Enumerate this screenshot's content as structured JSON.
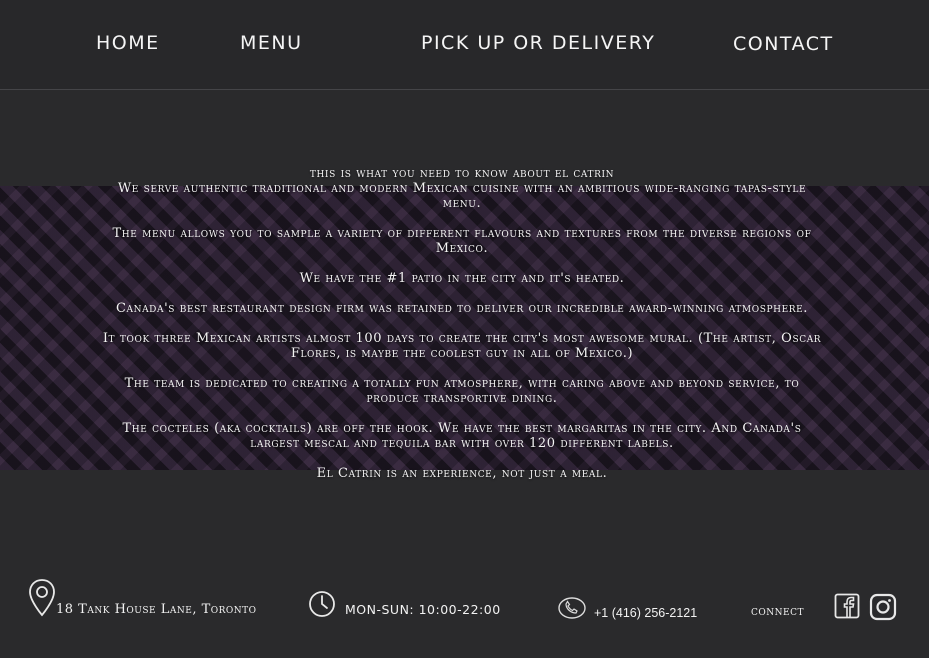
{
  "nav": {
    "home": "HOME",
    "menu": "MENU",
    "pickup": "PICK UP OR DELIVERY",
    "contact": "CONTACT"
  },
  "about": {
    "title": "this is what you need to know about el catrin",
    "paragraphs": [
      "We serve authentic traditional and modern Mexican cuisine with an ambitious wide-ranging tapas-style menu.",
      "The menu allows you to sample a variety of different flavours and textures from the diverse regions of Mexico.",
      "We have the #1 patio in the city and it's heated.",
      "Canada's best restaurant design firm was retained to deliver our incredible award-winning atmosphere.",
      "It took three Mexican artists almost 100 days to create the city's most awesome mural. (The artist, Oscar Flores, is maybe the coolest guy in all of Mexico.)",
      "The team is dedicated to creating a totally fun atmosphere, with caring above and beyond service, to produce transportive dining.",
      "The cocteles (aka cocktails) are off the hook. We have the best margaritas in the city. And Canada's largest mescal and tequila bar with over 120 different labels.",
      "El Catrin is an experience, not just a meal."
    ]
  },
  "footer": {
    "address": "18 Tank House Lane, Toronto",
    "hours": "MON-SUN: 10:00-22:00",
    "phone": "+1 (416) 256-2121",
    "connect": "connect"
  },
  "icons": {
    "location": "location-pin-icon",
    "clock": "clock-icon",
    "phone": "phone-icon",
    "facebook": "facebook-icon",
    "instagram": "instagram-icon"
  }
}
